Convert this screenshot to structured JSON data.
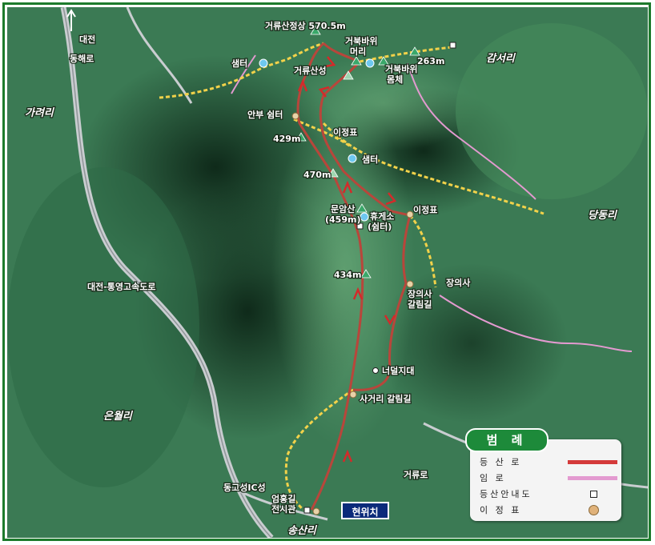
{
  "north_label": "대전",
  "places": {
    "dongbu_ro": "동해로",
    "garyeo_ri": "가려리",
    "gamseo_ri": "감서리",
    "dangdong_ri": "당동리",
    "eunwol_ri": "은월리",
    "songsan_ri": "송산리",
    "expressway": "대전-통영고속도로",
    "dong_goseong_ic": "동고성IC성",
    "georyu_ro": "거류로"
  },
  "peaks": {
    "summit": "거류산정상 570.5m",
    "turtle_head": "거북바위\n머리",
    "turtle_body": "거북바위\n몸체",
    "p263": "263m",
    "georyu_fortress": "거류산성",
    "p429": "429m",
    "p470": "470m",
    "munamsan": "문암산\n(459m)",
    "p434": "434m"
  },
  "facilities": {
    "shelter_left": "샘터",
    "shelter_mid": "샘터",
    "anbu_rest": "안부 쉼터",
    "milestone_1": "이정표",
    "milestone_2": "이정표",
    "rest_area": "휴게소\n(쉼터)",
    "jangui_temple": "장의사",
    "jangui_junction": "장의사\n갈림길",
    "rock_field": "너덜지대",
    "crossroad": "사거리 갈림길",
    "exhibit_hall": "엄홍길\n전시관",
    "current_location": "현위치"
  },
  "legend": {
    "title": "범 례",
    "items": [
      {
        "label": "등 산 로",
        "color": "#d43a3a"
      },
      {
        "label": "임 로",
        "color": "#e39ad0"
      },
      {
        "label": "등산안내도",
        "color": "#ffffff"
      },
      {
        "label": "이 정 표",
        "color": "#d9a060"
      }
    ]
  },
  "colors": {
    "hiking_trail": "#c0392b",
    "forest_road": "#e39ad0",
    "ridge_path": "#f2d24a",
    "terrain_dark": "#173824",
    "terrain_light": "#4a8a5c"
  }
}
